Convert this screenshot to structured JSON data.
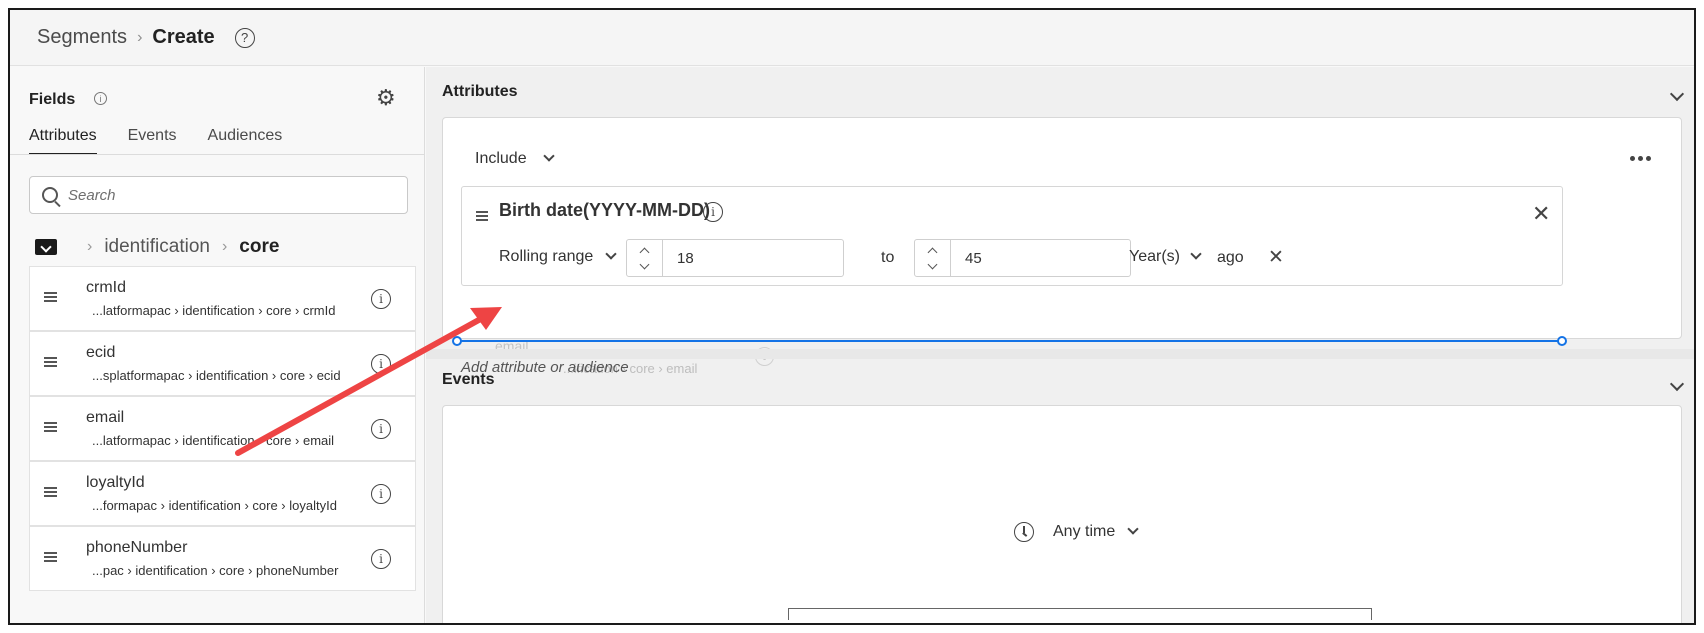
{
  "breadcrumb": {
    "parent": "Segments",
    "current": "Create"
  },
  "left_panel": {
    "title": "Fields",
    "tabs": [
      {
        "label": "Attributes",
        "active": true
      },
      {
        "label": "Events",
        "active": false
      },
      {
        "label": "Audiences",
        "active": false
      }
    ],
    "search_placeholder": "Search",
    "path": [
      "identification",
      "core"
    ],
    "fields": [
      {
        "name": "crmId",
        "path": "...latformapac › identification › core › crmId"
      },
      {
        "name": "ecid",
        "path": "...splatformapac › identification › core › ecid"
      },
      {
        "name": "email",
        "path": "...latformapac › identification › core › email"
      },
      {
        "name": "loyaltyId",
        "path": "...formapac › identification › core › loyaltyId"
      },
      {
        "name": "phoneNumber",
        "path": "...pac › identification › core › phoneNumber"
      }
    ]
  },
  "attributes_section": {
    "title": "Attributes",
    "include_label": "Include",
    "rule": {
      "title": "Birth date(YYYY-MM-DD)",
      "range_type": "Rolling range",
      "from": "18",
      "to_label": "to",
      "to": "45",
      "unit": "Year(s)",
      "suffix": "ago"
    },
    "add_placeholder": "Add attribute or audience",
    "drag_ghost": {
      "name": "email",
      "path": "...ification › core › email"
    }
  },
  "events_section": {
    "title": "Events",
    "time_filter": "Any time"
  },
  "colors": {
    "drop_indicator": "#1473e6",
    "annotation_arrow": "#ee4444"
  }
}
